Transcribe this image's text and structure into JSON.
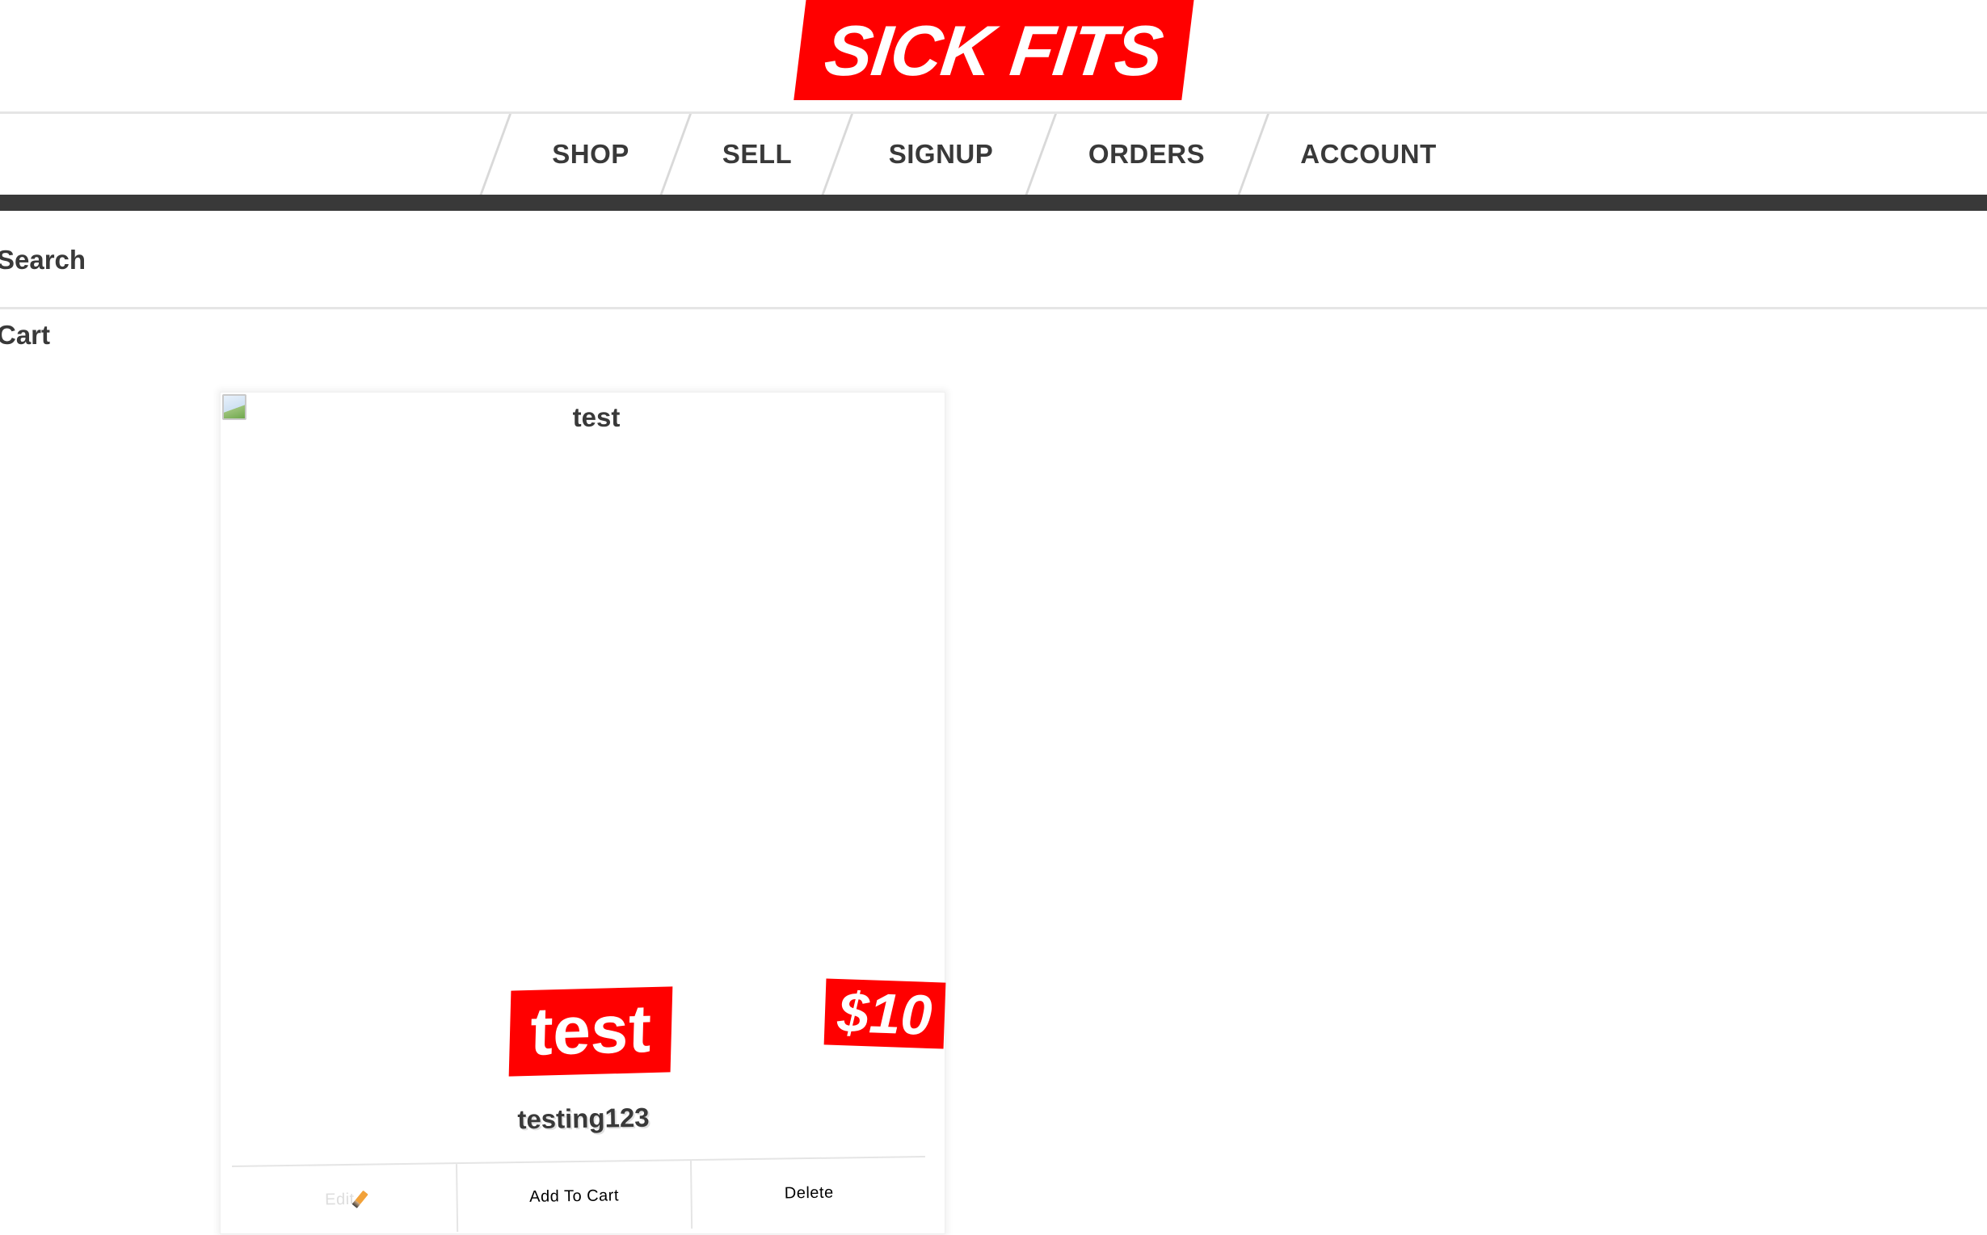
{
  "app": {
    "logo_text": "SICK FITS",
    "accent_color": "#ff0000",
    "text_color": "#393939"
  },
  "nav": {
    "items": [
      {
        "label": "SHOP"
      },
      {
        "label": "SELL"
      },
      {
        "label": "SIGNUP"
      },
      {
        "label": "ORDERS"
      },
      {
        "label": "ACCOUNT"
      }
    ]
  },
  "subheader": {
    "search_label": "Search",
    "cart_label": "Cart"
  },
  "items": [
    {
      "image_alt": "test",
      "title": "test",
      "price": "$10",
      "description": "testing123",
      "buttons": {
        "edit": "Edit",
        "edit_icon": "pencil-icon",
        "add_to_cart": "Add To Cart",
        "delete": "Delete"
      }
    }
  ]
}
